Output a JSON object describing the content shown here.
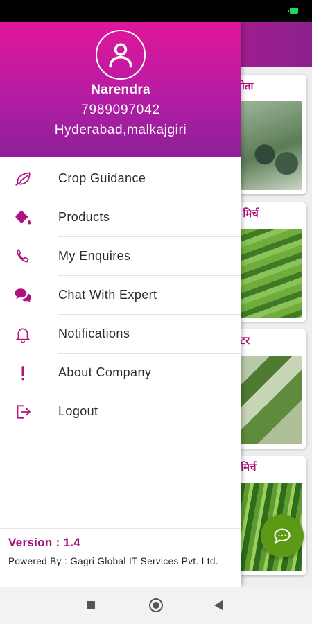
{
  "profile": {
    "avatar_icon": "user-icon",
    "name": "Narendra",
    "phone": "7989097042",
    "location": "Hyderabad,malkajgiri"
  },
  "menu": [
    {
      "label": "Crop Guidance",
      "icon": "leaf-icon"
    },
    {
      "label": "Products",
      "icon": "paint-bucket-icon"
    },
    {
      "label": "My Enquires",
      "icon": "phone-icon"
    },
    {
      "label": "Chat With Expert",
      "icon": "chat-bubbles-icon"
    },
    {
      "label": "Notifications",
      "icon": "bell-icon"
    },
    {
      "label": "About Company",
      "icon": "exclamation-icon"
    },
    {
      "label": "Logout",
      "icon": "logout-icon"
    }
  ],
  "footer": {
    "version": "Version : 1.4",
    "powered_by": "Powered By : Gagri Global IT Services Pvt. Ltd."
  },
  "background_crops": [
    {
      "name": "पपीता"
    },
    {
      "name": "शिमला मिर्च"
    },
    {
      "name": "टमाटर"
    },
    {
      "name": "हरी मिर्च"
    }
  ],
  "colors": {
    "accent": "#b0127e",
    "header_gradient_top": "#e0169a",
    "header_gradient_bottom": "#8d2199",
    "fab": "#5c9a16"
  }
}
